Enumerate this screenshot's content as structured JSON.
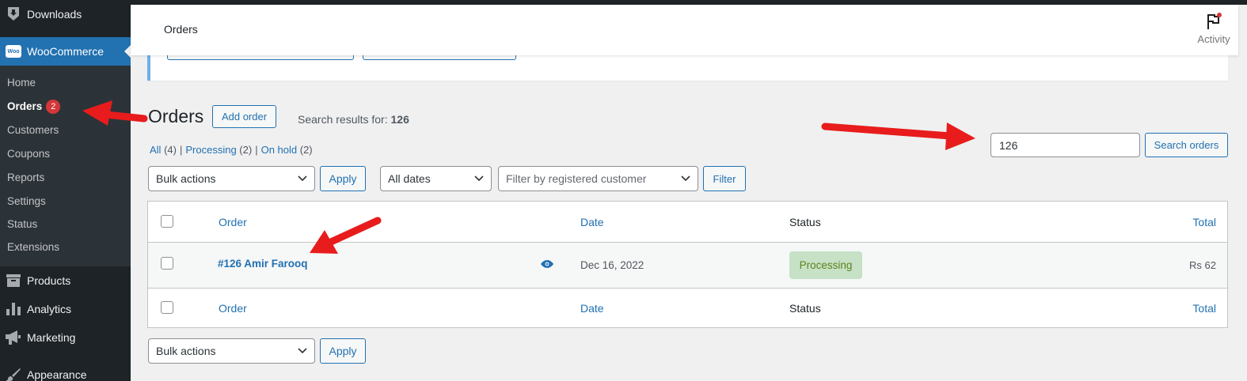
{
  "sidebar": {
    "downloads_label": "Downloads",
    "woocommerce_label": "WooCommerce",
    "woo_logo_text": "Woo",
    "submenu": [
      {
        "label": "Home"
      },
      {
        "label": "Orders",
        "badge": "2"
      },
      {
        "label": "Customers"
      },
      {
        "label": "Coupons"
      },
      {
        "label": "Reports"
      },
      {
        "label": "Settings"
      },
      {
        "label": "Status"
      },
      {
        "label": "Extensions"
      }
    ],
    "products_label": "Products",
    "analytics_label": "Analytics",
    "marketing_label": "Marketing",
    "appearance_label": "Appearance"
  },
  "header": {
    "title": "Orders",
    "activity_label": "Activity"
  },
  "page": {
    "title": "Orders",
    "add_order_label": "Add order",
    "search_results_prefix": "Search results for: ",
    "search_query": "126"
  },
  "filters": {
    "all_label": "All",
    "all_count": "(4)",
    "processing_label": "Processing",
    "processing_count": "(2)",
    "onhold_label": "On hold",
    "onhold_count": "(2)",
    "separator": "|"
  },
  "search": {
    "value": "126",
    "button_label": "Search orders"
  },
  "toolbar": {
    "bulk_actions": "Bulk actions",
    "apply_label": "Apply",
    "all_dates": "All dates",
    "customer_placeholder": "Filter by registered customer",
    "filter_label": "Filter"
  },
  "table": {
    "columns": {
      "order": "Order",
      "date": "Date",
      "status": "Status",
      "total": "Total"
    },
    "rows": [
      {
        "order": "#126 Amir Farooq",
        "date": "Dec 16, 2022",
        "status": "Processing",
        "total": "Rs 62"
      }
    ]
  },
  "bottom_toolbar": {
    "bulk_actions": "Bulk actions",
    "apply_label": "Apply"
  },
  "colors": {
    "sidebar_bg": "#1d2327",
    "accent": "#2271b1",
    "badge": "#d63638",
    "status_processing_bg": "#c6e1c6",
    "status_processing_fg": "#5b841b",
    "arrow": "#e81c1c"
  }
}
